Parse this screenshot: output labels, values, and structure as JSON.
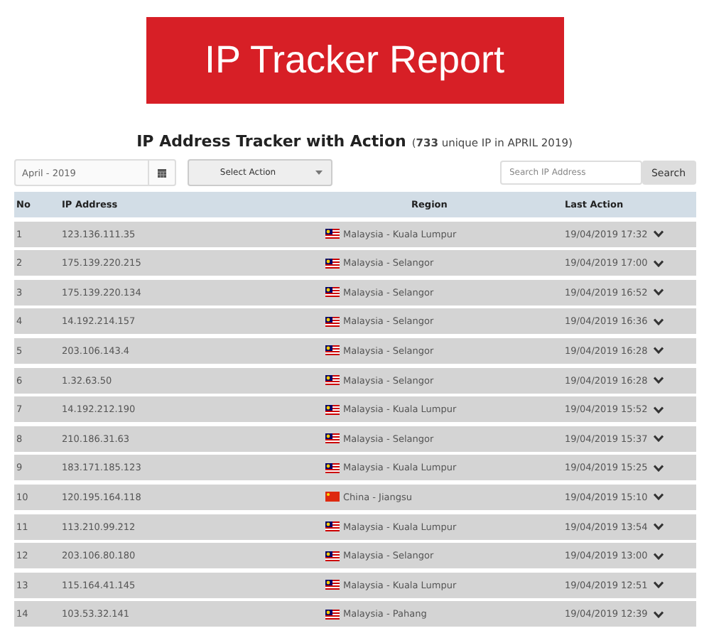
{
  "banner": {
    "title": "IP Tracker Report"
  },
  "heading": {
    "title": "IP Address Tracker with Action",
    "subtitle": "(**733** unique IP in APRIL 2019)"
  },
  "toolbar": {
    "month": "April - 2019",
    "action": "Select Action",
    "search": {
      "placeholder": "Search IP Address"
    },
    "search_button": "Search"
  },
  "table": {
    "columns": [
      "No",
      "IP Address",
      "Region",
      "Last Action"
    ],
    "rows": [
      {
        "no": "1",
        "ip": "123.136.111.35",
        "kind": "malaysia",
        "region": "Malaysia - Kuala Lumpur",
        "last_action": "19/04/2019 17:32"
      },
      {
        "no": "2",
        "ip": "175.139.220.215",
        "kind": "malaysia",
        "region": "Malaysia - Selangor",
        "last_action": "19/04/2019 17:00"
      },
      {
        "no": "3",
        "ip": "175.139.220.134",
        "kind": "malaysia",
        "region": "Malaysia - Selangor",
        "last_action": "19/04/2019 16:52"
      },
      {
        "no": "4",
        "ip": "14.192.214.157",
        "kind": "malaysia",
        "region": "Malaysia - Selangor",
        "last_action": "19/04/2019 16:36"
      },
      {
        "no": "5",
        "ip": "203.106.143.4",
        "kind": "malaysia",
        "region": "Malaysia - Selangor",
        "last_action": "19/04/2019 16:28"
      },
      {
        "no": "6",
        "ip": "1.32.63.50",
        "kind": "malaysia",
        "region": "Malaysia - Selangor",
        "last_action": "19/04/2019 16:28"
      },
      {
        "no": "7",
        "ip": "14.192.212.190",
        "kind": "malaysia",
        "region": "Malaysia - Kuala Lumpur",
        "last_action": "19/04/2019 15:52"
      },
      {
        "no": "8",
        "ip": "210.186.31.63",
        "kind": "malaysia",
        "region": "Malaysia - Selangor",
        "last_action": "19/04/2019 15:37"
      },
      {
        "no": "9",
        "ip": "183.171.185.123",
        "kind": "malaysia",
        "region": "Malaysia - Kuala Lumpur",
        "last_action": "19/04/2019 15:25"
      },
      {
        "no": "10",
        "ip": "120.195.164.118",
        "kind": "china",
        "region": "China - Jiangsu",
        "last_action": "19/04/2019 15:10"
      },
      {
        "no": "11",
        "ip": "113.210.99.212",
        "kind": "malaysia",
        "region": "Malaysia - Kuala Lumpur",
        "last_action": "19/04/2019 13:54"
      },
      {
        "no": "12",
        "ip": "203.106.80.180",
        "kind": "malaysia",
        "region": "Malaysia - Selangor",
        "last_action": "19/04/2019 13:00"
      },
      {
        "no": "13",
        "ip": "115.164.41.145",
        "kind": "malaysia",
        "region": "Malaysia - Kuala Lumpur",
        "last_action": "19/04/2019 12:51"
      },
      {
        "no": "14",
        "ip": "103.53.32.141",
        "kind": "malaysia",
        "region": "Malaysia - Pahang",
        "last_action": "19/04/2019 12:39"
      }
    ]
  }
}
